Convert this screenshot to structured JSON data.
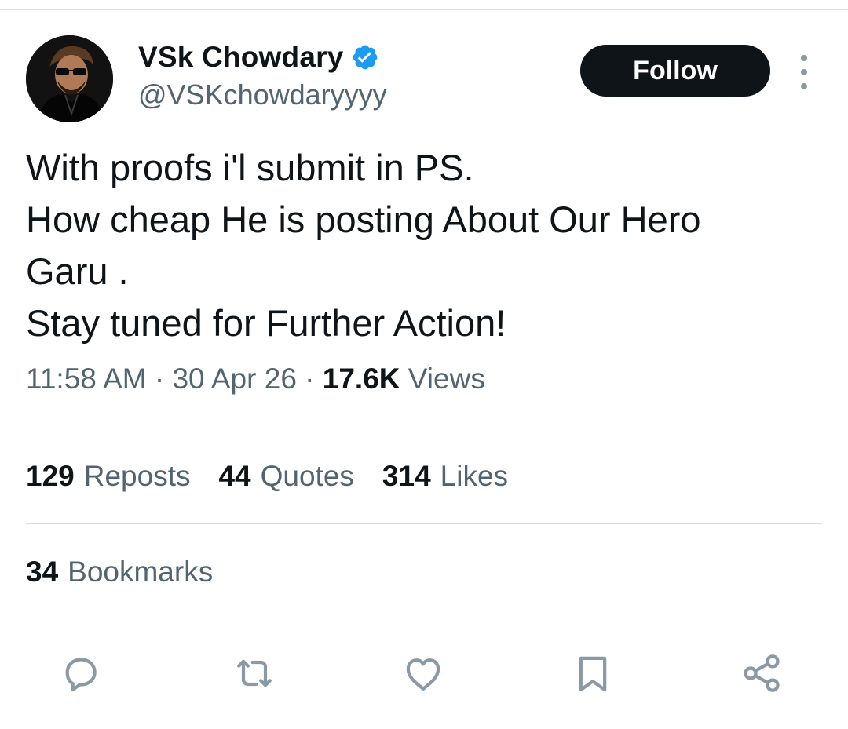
{
  "author": {
    "display_name": "VSk Chowdary",
    "handle": "@VSKchowdaryyyy",
    "verified": true
  },
  "header": {
    "follow_label": "Follow"
  },
  "tweet": {
    "lines": [
      "With proofs i'l submit in PS.",
      "How cheap He is posting About Our Hero",
      "Garu .",
      "Stay tuned for Further Action!"
    ]
  },
  "meta": {
    "time": "11:58 AM",
    "separator": "·",
    "date": "30 Apr 26",
    "views_count": "17.6K",
    "views_label": "Views"
  },
  "stats": {
    "reposts_count": "129",
    "reposts_label": "Reposts",
    "quotes_count": "44",
    "quotes_label": "Quotes",
    "likes_count": "314",
    "likes_label": "Likes",
    "bookmarks_count": "34",
    "bookmarks_label": "Bookmarks"
  },
  "actions": [
    {
      "icon": "reply-icon"
    },
    {
      "icon": "repost-icon"
    },
    {
      "icon": "like-icon"
    },
    {
      "icon": "bookmark-icon"
    },
    {
      "icon": "share-icon"
    }
  ],
  "colors": {
    "text_primary": "#0f1419",
    "text_secondary": "#536471",
    "verified_blue": "#1d9bf0",
    "divider": "#d9dde0",
    "icon_gray": "#8b98a5"
  }
}
